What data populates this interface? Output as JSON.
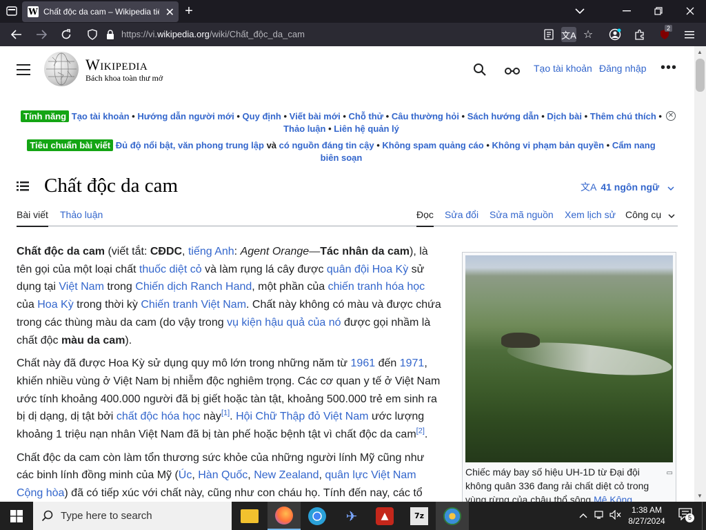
{
  "browser": {
    "tab": {
      "favicon": "W",
      "title": "Chất độc da cam – Wikipedia tiếng Việt"
    },
    "url": {
      "prefix": "https://vi.",
      "domain": "wikipedia.org",
      "path": "/wiki/Chất_độc_da_cam"
    },
    "extension_badge": "2"
  },
  "header": {
    "wordmark": "Wikipedia",
    "tagline": "Bách khoa toàn thư mở",
    "create_account": "Tạo tài khoản",
    "login": "Đăng nhập",
    "more": "•••"
  },
  "sitenotice": {
    "row1_label": "Tính năng",
    "row1_links": [
      "Tạo tài khoản",
      "Hướng dẫn người mới",
      "Quy định",
      "Viết bài mới",
      "Chỗ thử",
      "Câu thường hỏi",
      "Sách hướng dẫn",
      "Dịch bài",
      "Thêm chú thích",
      "Thảo luận",
      "Liên hệ quản lý"
    ],
    "row2_label": "Tiêu chuẩn bài viết",
    "row2_link1": "Đủ độ nổi bật, văn phong trung lập",
    "row2_and": " và ",
    "row2_link2": "có nguồn đáng tin cậy",
    "row2_links": [
      "Không spam quảng cáo",
      "Không vi phạm bản quyền",
      "Cẩm nang biên soạn"
    ],
    "separator": " • "
  },
  "page": {
    "title": "Chất độc da cam",
    "languages": "41 ngôn ngữ",
    "tabs_left": [
      "Bài viết",
      "Thảo luận"
    ],
    "tabs_right": [
      "Đọc",
      "Sửa đổi",
      "Sửa mã nguồn",
      "Xem lịch sử"
    ],
    "tools": "Công cụ"
  },
  "article": {
    "p1": [
      {
        "t": "Chất độc da cam",
        "b": true
      },
      {
        "t": " (viết tắt: "
      },
      {
        "t": "CĐDC",
        "b": true
      },
      {
        "t": ", "
      },
      {
        "t": "tiếng Anh",
        "l": true
      },
      {
        "t": ": "
      },
      {
        "t": "Agent Orange",
        "i": true
      },
      {
        "t": "—"
      },
      {
        "t": "Tác nhân da cam",
        "b": true
      },
      {
        "t": "), là tên gọi của một loại chất "
      },
      {
        "t": "thuốc diệt cỏ",
        "l": true
      },
      {
        "t": " và làm rụng lá cây được "
      },
      {
        "t": "quân đội Hoa Kỳ",
        "l": true
      },
      {
        "t": " sử dụng tại "
      },
      {
        "t": "Việt Nam",
        "l": true
      },
      {
        "t": " trong "
      },
      {
        "t": "Chiến dịch Ranch Hand",
        "l": true
      },
      {
        "t": ", một phần của "
      },
      {
        "t": "chiến tranh hóa học",
        "l": true
      },
      {
        "t": " của "
      },
      {
        "t": "Hoa Kỳ",
        "l": true
      },
      {
        "t": " trong thời kỳ "
      },
      {
        "t": "Chiến tranh Việt Nam",
        "l": true
      },
      {
        "t": ". Chất này không có màu và được chứa trong các thùng màu da cam (do vậy trong "
      },
      {
        "t": "vụ kiện hậu quả của nó",
        "l": true
      },
      {
        "t": " được gọi nhầm là chất độc "
      },
      {
        "t": "màu da cam",
        "b": true
      },
      {
        "t": ")."
      }
    ],
    "p2": [
      {
        "t": "Chất này đã được Hoa Kỳ sử dụng quy mô lớn trong những năm từ "
      },
      {
        "t": "1961",
        "l": true
      },
      {
        "t": " đến "
      },
      {
        "t": "1971",
        "l": true
      },
      {
        "t": ", khiến nhiều vùng ở Việt Nam bị nhiễm độc nghiêm trọng. Các cơ quan y tế ở Việt Nam ước tính khoảng 400.000 người đã bị giết hoặc tàn tật, khoảng 500.000 trẻ em sinh ra bị dị dạng, dị tật bởi "
      },
      {
        "t": "chất độc hóa học",
        "l": true
      },
      {
        "t": " này"
      },
      {
        "t": "[1]",
        "s": true
      },
      {
        "t": ". "
      },
      {
        "t": "Hội Chữ Thập đỏ Việt Nam",
        "l": true
      },
      {
        "t": " ước lượng khoảng 1 triệu nạn nhân Việt Nam đã bị tàn phế hoặc bệnh tật vì chất độc da cam"
      },
      {
        "t": "[2]",
        "s": true
      },
      {
        "t": "."
      }
    ],
    "p3": [
      {
        "t": "Chất độc da cam còn làm tổn thương sức khỏe của những người lính Mỹ cũng như các binh lính đồng minh của Mỹ ("
      },
      {
        "t": "Úc",
        "l": true
      },
      {
        "t": ", "
      },
      {
        "t": "Hàn Quốc",
        "l": true
      },
      {
        "t": ", "
      },
      {
        "t": "New Zealand",
        "l": true
      },
      {
        "t": ", "
      },
      {
        "t": "quân lực Việt Nam Cộng hòa",
        "l": true
      },
      {
        "t": ") đã có tiếp xúc với chất này, cũng như con cháu họ. Tính đến nay, các tổ"
      }
    ]
  },
  "infobox": {
    "caption_text": "Chiếc máy bay số hiệu UH-1D từ Đại đội không quân 336 đang rải chất diệt cỏ trong vùng rừng của châu thổ sông ",
    "caption_link": "Mê Kông",
    "enlarge_icon": "magnify-clip"
  },
  "taskbar": {
    "search_placeholder": "Type here to search",
    "time": "1:38 AM",
    "date": "8/27/2024",
    "notifications": "5"
  }
}
